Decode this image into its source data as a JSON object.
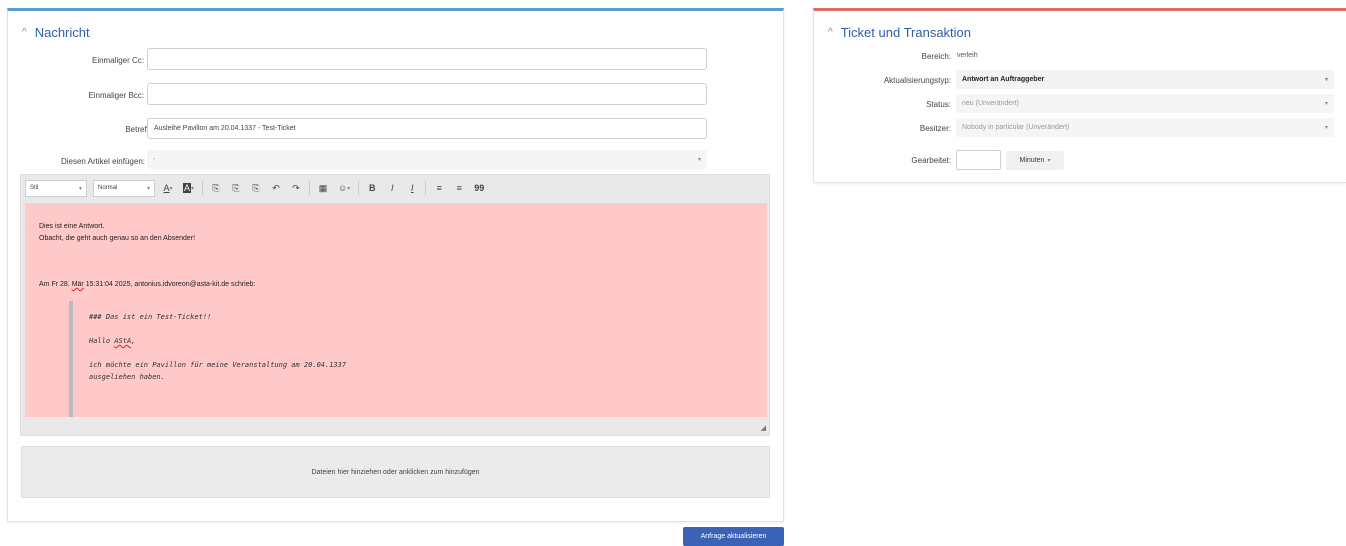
{
  "message_panel": {
    "title": "Nachricht",
    "cc_label": "Einmaliger Cc:",
    "cc_value": "",
    "bcc_label": "Einmaliger Bcc:",
    "bcc_value": "",
    "subject_label": "Betreff:",
    "subject_value": "Ausleihe Pavillon am 20.04.1337 - Test-Ticket",
    "insert_article_label": "Diesen Artikel einfügen:",
    "insert_article_value": "-"
  },
  "editor": {
    "toolbar": {
      "style_select": "Stil",
      "format_select": "Normal",
      "buttons": [
        "A",
        "A",
        "⎘",
        "⎘",
        "⎘",
        "↶",
        "↷",
        "▦",
        "☺",
        "B",
        "I",
        "I",
        "≡",
        "≡",
        "99"
      ]
    },
    "body_lines": [
      "Dies ist eine Antwort.",
      "Obacht, die geht auch genau so an den Absender!"
    ],
    "reply_header_prefix": "Am Fr 28. ",
    "reply_header_month": "Mär",
    "reply_header_suffix": " 15:31:04 2025, antonius.idvoreon@asta-kit.de schrieb:",
    "quote_lines": {
      "l1": "### Das ist ein Test-Ticket!!",
      "l2_prefix": "Hallo ",
      "l2_word": "AStA",
      "l2_suffix": ",",
      "l3": "ich möchte ein Pavillon für meine Veranstaltung am 20.04.1337",
      "l4": "ausgeliehen haben."
    }
  },
  "dropzone": {
    "text": "Dateien hier hinziehen oder anklicken zum hinzufügen"
  },
  "submit": {
    "label": "Anfrage aktualisieren"
  },
  "ticket_panel": {
    "title": "Ticket und Transaktion",
    "bereich_label": "Bereich:",
    "bereich_value": "verleih",
    "update_type_label": "Aktualisierungstyp:",
    "update_type_value": "Antwort an Auftraggeber",
    "status_label": "Status:",
    "status_value": "neu (Unverändert)",
    "owner_label": "Besitzer:",
    "owner_value": "Nobody in particular (Unverändert)",
    "worked_label": "Gearbeitet:",
    "worked_value": "",
    "minutes_label": "Minuten"
  },
  "colors": {
    "accent_blue": "#5b9bd5",
    "accent_red": "#e06a6a",
    "editor_bg": "#ffc9c9",
    "submit_bg": "#3a63b8"
  }
}
